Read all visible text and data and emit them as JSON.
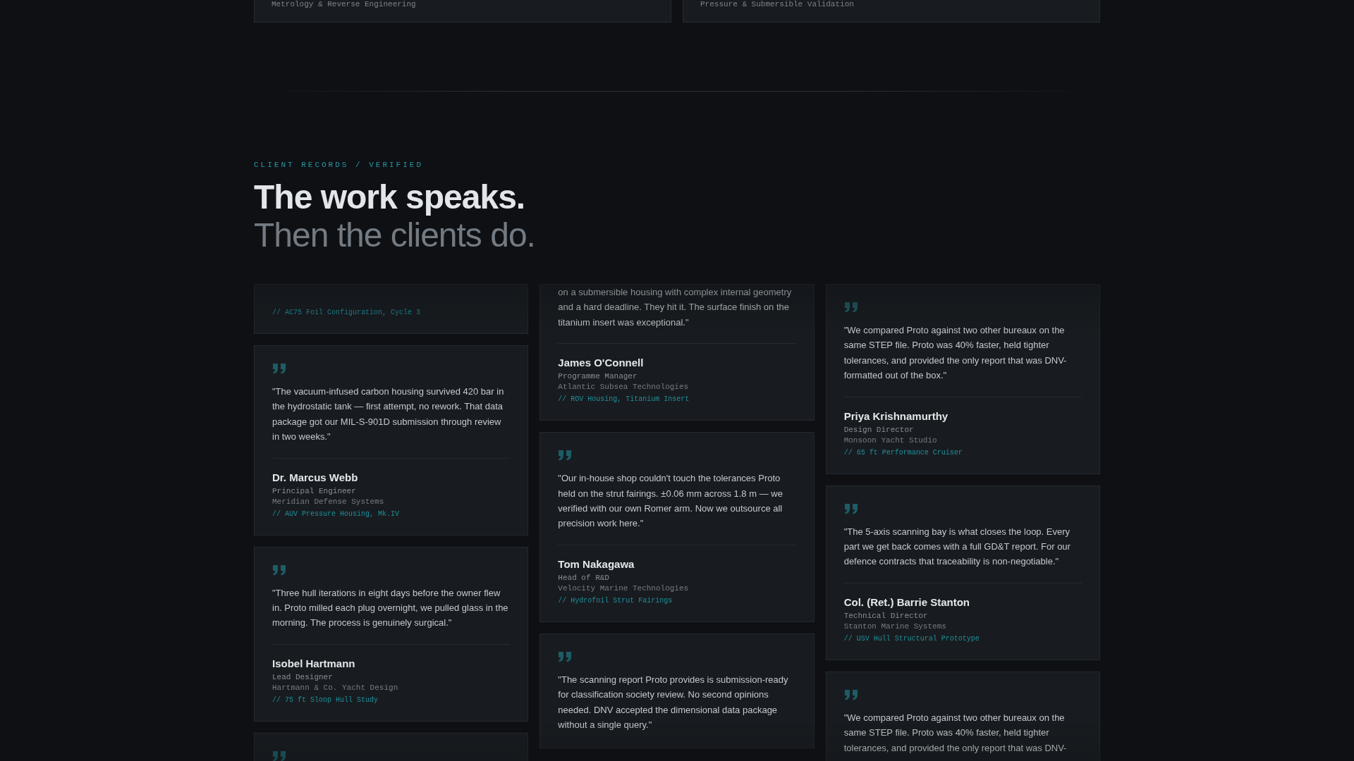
{
  "services": [
    {
      "caption": "Metrology & Reverse Engineering"
    },
    {
      "caption": "Pressure & Submersible Validation"
    }
  ],
  "section": {
    "eyebrow": "CLIENT RECORDS / VERIFIED",
    "headline": "The work speaks.",
    "subheadline": "Then the clients do."
  },
  "columns": [
    {
      "cards": [
        {
          "kind": "continued",
          "project": "// AC75 Foil Configuration, Cycle 3"
        },
        {
          "kind": "full",
          "quote": "\"The vacuum-infused carbon housing survived 420 bar in the hydrostatic tank — first attempt, no rework. That data package got our MIL-S-901D submission through review in two weeks.\"",
          "name": "Dr. Marcus Webb",
          "role": "Principal Engineer",
          "company": "Meridian Defense Systems",
          "project": "// AUV Pressure Housing, Mk.IV"
        },
        {
          "kind": "full",
          "quote": "\"Three hull iterations in eight days before the owner flew in. Proto milled each plug overnight, we pulled glass in the morning. The process is genuinely surgical.\"",
          "name": "Isobel Hartmann",
          "role": "Lead Designer",
          "company": "Hartmann & Co. Yacht Design",
          "project": "// 75 ft Sloop Hull Study"
        },
        {
          "kind": "full"
        }
      ]
    },
    {
      "cards": [
        {
          "kind": "continued",
          "quote": "on a submersible housing with complex internal geometry and a hard deadline. They hit it. The surface finish on the titanium insert was exceptional.\"",
          "name": "James O'Connell",
          "role": "Programme Manager",
          "company": "Atlantic Subsea Technologies",
          "project": "// ROV Housing, Titanium Insert"
        },
        {
          "kind": "full",
          "quote": "\"Our in-house shop couldn't touch the tolerances Proto held on the strut fairings. ±0.06 mm across 1.8 m — we verified with our own Romer arm. Now we outsource all precision work here.\"",
          "name": "Tom Nakagawa",
          "role": "Head of R&D",
          "company": "Velocity Marine Technologies",
          "project": "// Hydrofoil Strut Fairings"
        },
        {
          "kind": "full",
          "quote": "\"The scanning report Proto provides is submission-ready for classification society review. No second opinions needed. DNV accepted the dimensional data package without a single query.\""
        }
      ]
    },
    {
      "cards": [
        {
          "kind": "full",
          "quote": "\"We compared Proto against two other bureaux on the same STEP file. Proto was 40% faster, held tighter tolerances, and provided the only report that was DNV-formatted out of the box.\"",
          "name": "Priya Krishnamurthy",
          "role": "Design Director",
          "company": "Monsoon Yacht Studio",
          "project": "// 65 ft Performance Cruiser"
        },
        {
          "kind": "full",
          "quote": "\"The 5-axis scanning bay is what closes the loop. Every part we get back comes with a full GD&T report. For our defence contracts that traceability is non-negotiable.\"",
          "name": "Col. (Ret.) Barrie Stanton",
          "role": "Technical Director",
          "company": "Stanton Marine Systems",
          "project": "// USV Hull Structural Prototype"
        },
        {
          "kind": "full",
          "quote": "\"We compared Proto against two other bureaux on the same STEP file. Proto was 40% faster, held tighter tolerances, and provided the only report that was DNV-"
        }
      ]
    }
  ]
}
